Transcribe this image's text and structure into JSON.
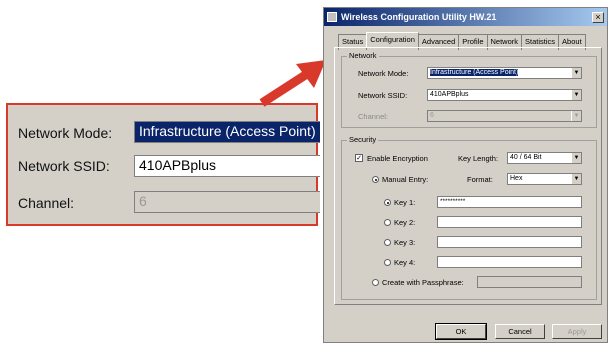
{
  "callout": {
    "network_mode_label": "Network Mode:",
    "network_mode_value": "Infrastructure (Access Point)",
    "ssid_label": "Network SSID:",
    "ssid_value": "410APBplus",
    "channel_label": "Channel:",
    "channel_value": "6"
  },
  "dialog": {
    "title": "Wireless Configuration Utility HW.21",
    "close": "×",
    "tabs": [
      "Status",
      "Configuration",
      "Advanced",
      "Profile",
      "Network",
      "Statistics",
      "About"
    ],
    "active_tab": "Configuration",
    "network_group": {
      "title": "Network",
      "mode_label": "Network Mode:",
      "mode_value": "Infrastructure (Access Point)",
      "ssid_label": "Network SSID:",
      "ssid_value": "410APBplus",
      "channel_label": "Channel:",
      "channel_value": "6"
    },
    "security_group": {
      "title": "Security",
      "enable_encryption_label": "Enable Encryption",
      "enable_encryption_checked": true,
      "key_length_label": "Key Length:",
      "key_length_value": "40 / 64 Bit",
      "manual_entry_label": "Manual Entry:",
      "format_label": "Format:",
      "format_value": "Hex",
      "key1_label": "Key 1:",
      "key1_value": "**********",
      "key2_label": "Key 2:",
      "key3_label": "Key 3:",
      "key4_label": "Key 4:",
      "passphrase_label": "Create with Passphrase:"
    },
    "buttons": {
      "ok": "OK",
      "cancel": "Cancel",
      "apply": "Apply"
    }
  },
  "colors": {
    "highlight": "#0a246a",
    "callout_border": "#d8392a",
    "face": "#d4d0c8"
  }
}
